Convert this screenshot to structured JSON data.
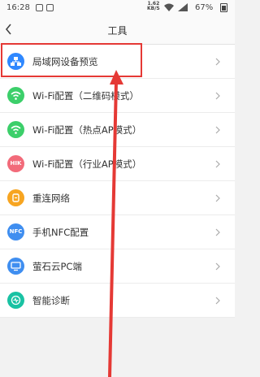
{
  "status": {
    "time": "16:28",
    "net_speed": "1.62",
    "net_unit": "KB/S",
    "battery": "67%"
  },
  "header": {
    "title": "工具"
  },
  "menu": [
    {
      "label": "局域网设备预览",
      "icon": "lan-devices-icon",
      "color": "#2f88ff",
      "glyph": ""
    },
    {
      "label": "Wi-Fi配置（二维码模式）",
      "icon": "wifi-icon",
      "color": "#3ccf6a",
      "glyph": ""
    },
    {
      "label": "Wi-Fi配置（热点AP模式）",
      "icon": "wifi-icon",
      "color": "#3ccf6a",
      "glyph": ""
    },
    {
      "label": "Wi-Fi配置（行业AP模式）",
      "icon": "hik-icon",
      "color": "#f26b7a",
      "glyph": "HIK"
    },
    {
      "label": "重连网络",
      "icon": "reconnect-icon",
      "color": "#f7a521",
      "glyph": ""
    },
    {
      "label": "手机NFC配置",
      "icon": "nfc-icon",
      "color": "#3f8ef0",
      "glyph": "NFC"
    },
    {
      "label": "萤石云PC端",
      "icon": "pc-client-icon",
      "color": "#3f8ef0",
      "glyph": ""
    },
    {
      "label": "智能诊断",
      "icon": "diagnosis-icon",
      "color": "#19c2a3",
      "glyph": ""
    }
  ]
}
